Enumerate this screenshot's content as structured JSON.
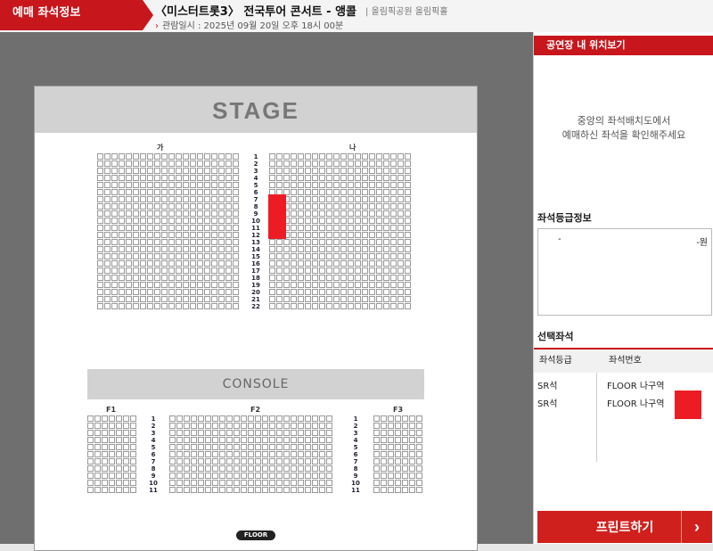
{
  "header": {
    "tab_label": "예매 좌석정보",
    "concert_title": "〈미스터트롯3〉 전국투어 콘서트 - 앵콜",
    "venue": "| 올림픽공원 올림픽홀",
    "view_date": "관람일시 : 2025년 09월 20일 오후 18시 00분"
  },
  "seatmap": {
    "stage_label": "STAGE",
    "console_label": "CONSOLE",
    "floor_label": "FLOOR",
    "upper_sections": [
      "가",
      "나"
    ],
    "upper_rows": [
      "1",
      "2",
      "3",
      "4",
      "5",
      "6",
      "7",
      "8",
      "9",
      "10",
      "11",
      "12",
      "13",
      "14",
      "15",
      "16",
      "17",
      "18",
      "19",
      "20",
      "21",
      "22"
    ],
    "floor_sections": [
      "F1",
      "F2",
      "F3"
    ],
    "floor_rows": [
      "1",
      "2",
      "3",
      "4",
      "5",
      "6",
      "7",
      "8",
      "9",
      "10",
      "11"
    ]
  },
  "side": {
    "location_title": "공연장 내 위치보기",
    "location_msg": [
      "중앙의 좌석배치도에서",
      "예매하신 좌석을 확인해주세요"
    ],
    "grade_title": "좌석등급정보",
    "grade_dash": "-",
    "grade_price": "-원",
    "selected_title": "선택좌석",
    "col_grade": "좌석등급",
    "col_seat": "좌석번호",
    "selected": [
      {
        "grade": "SR석",
        "seat": "FLOOR 나구역"
      },
      {
        "grade": "SR석",
        "seat": "FLOOR 나구역"
      }
    ],
    "selected_color": "#ed1c24",
    "print_label": "프린트하기"
  }
}
